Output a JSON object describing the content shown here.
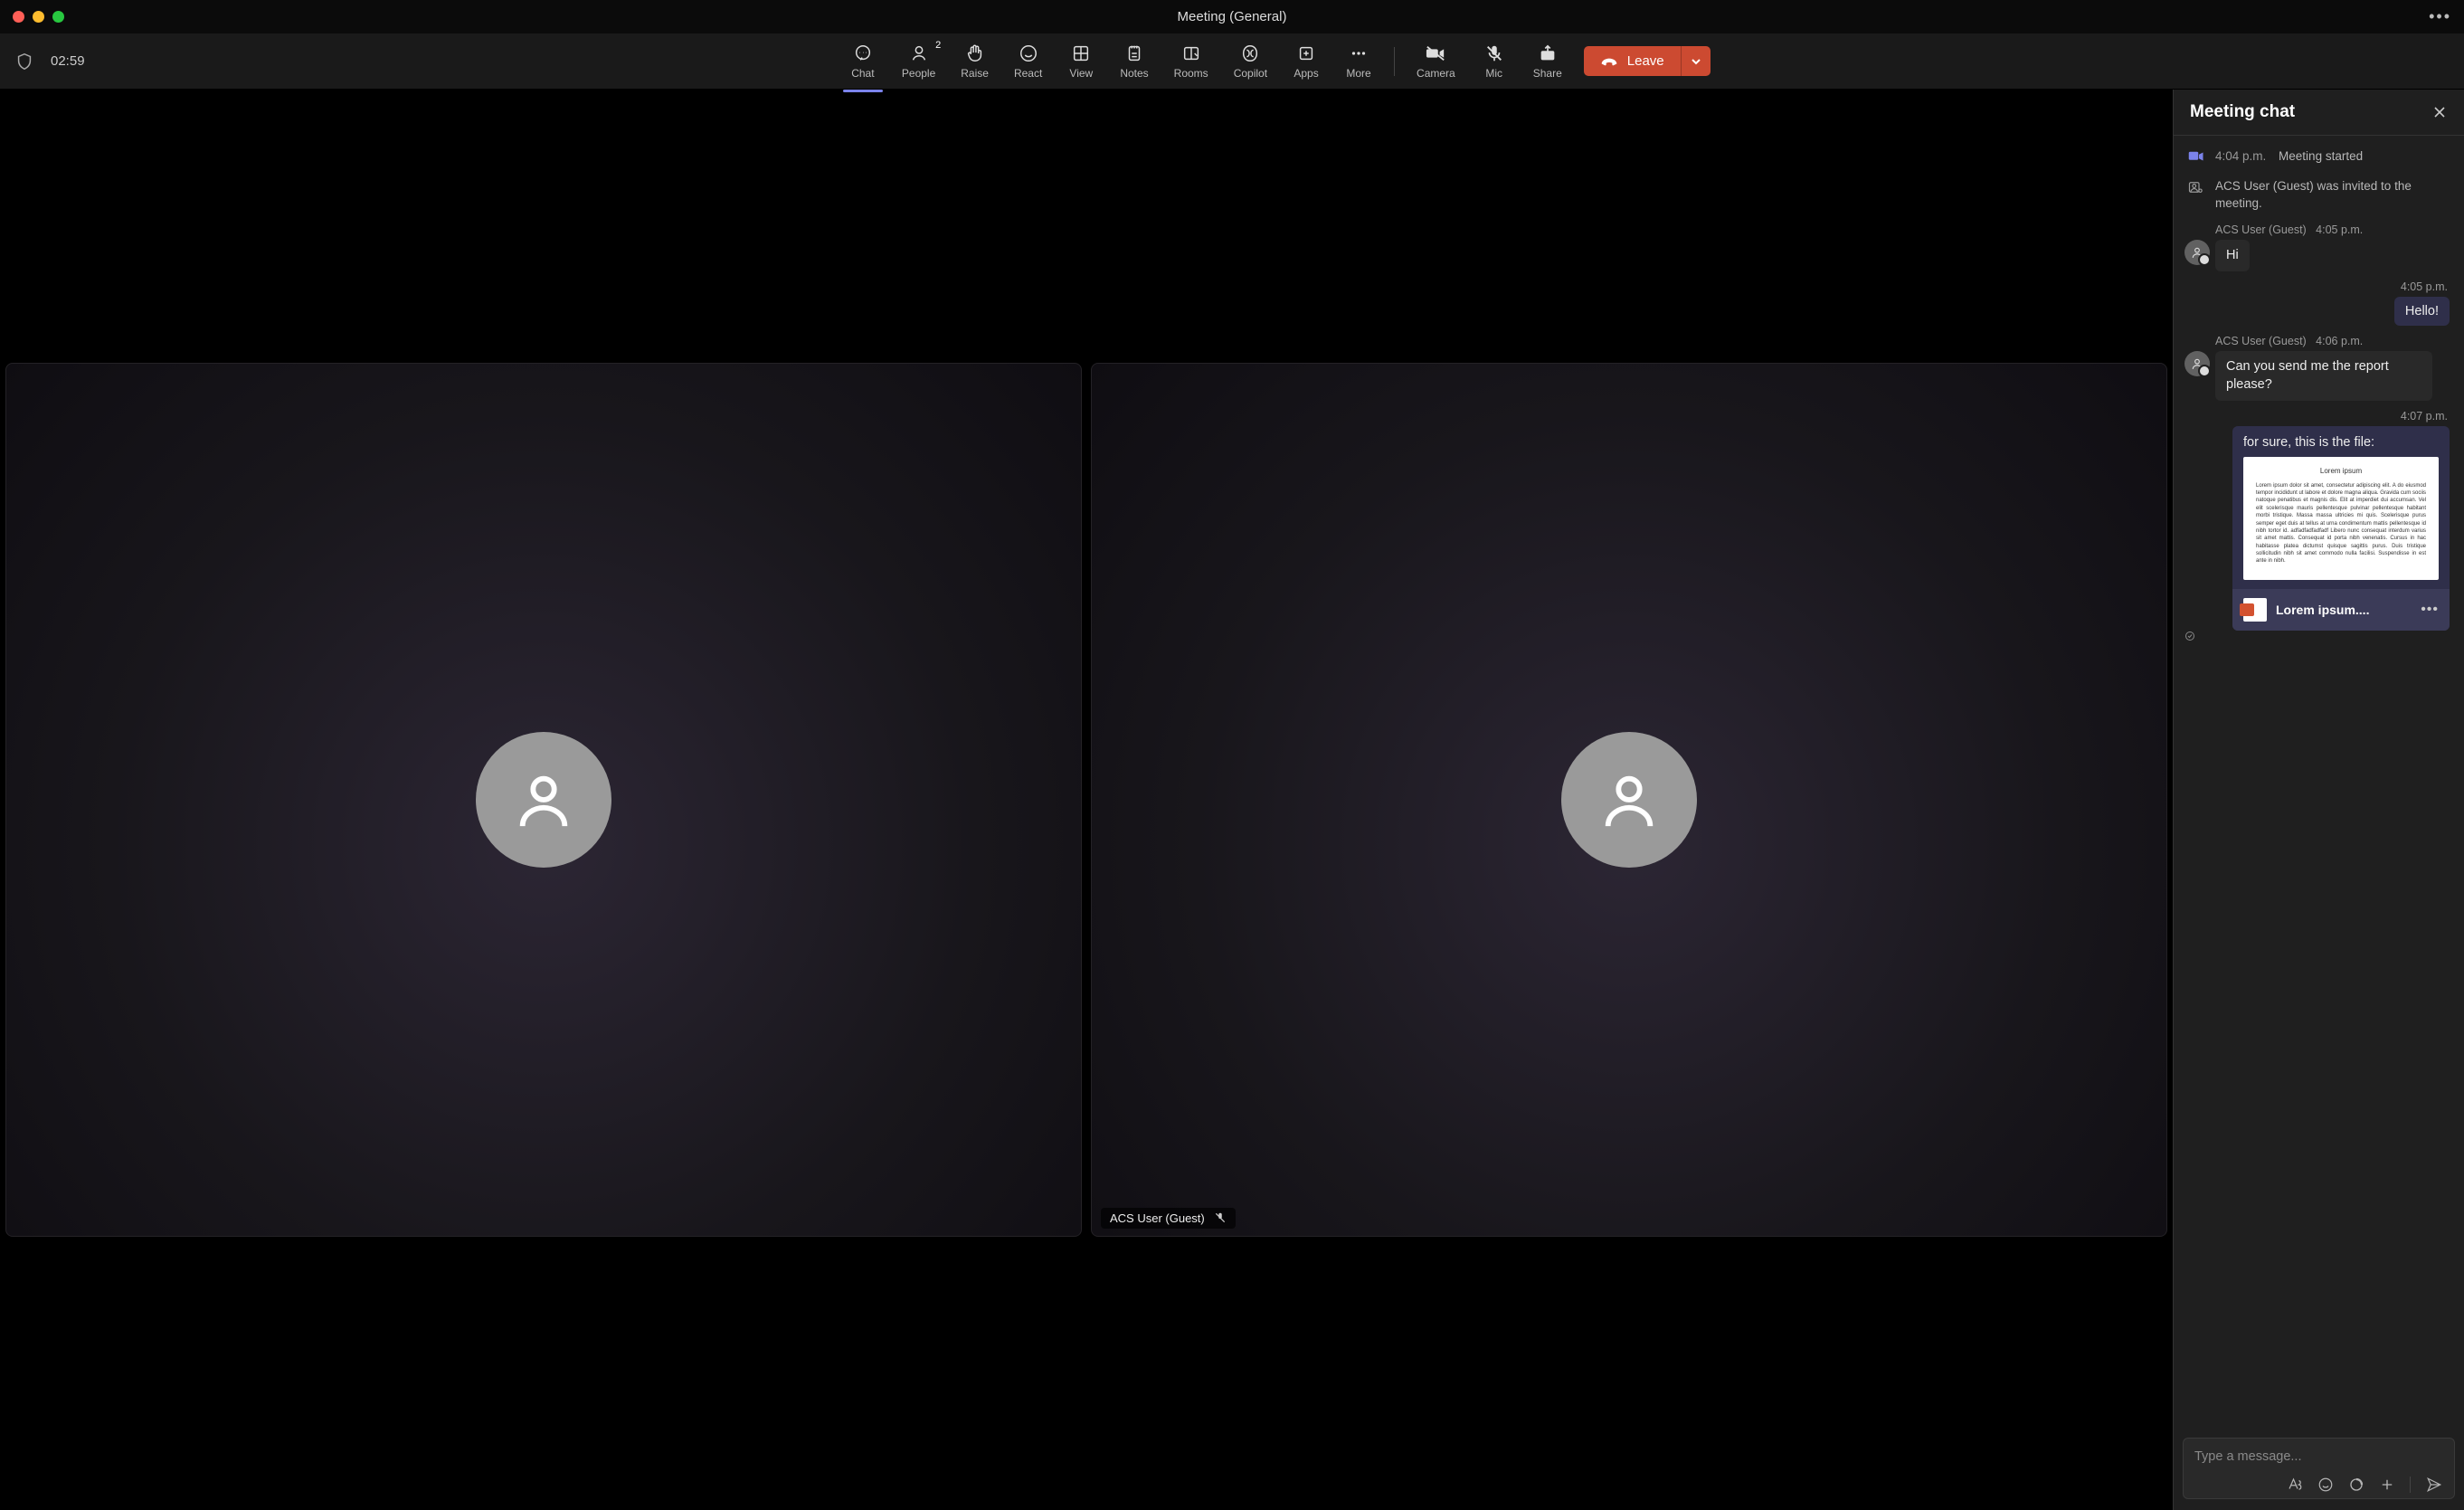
{
  "window": {
    "title": "Meeting (General)"
  },
  "toolbar": {
    "timer": "02:59",
    "buttons": {
      "chat": "Chat",
      "people": "People",
      "people_count": "2",
      "raise": "Raise",
      "react": "React",
      "view": "View",
      "notes": "Notes",
      "rooms": "Rooms",
      "copilot": "Copilot",
      "apps": "Apps",
      "more": "More",
      "camera": "Camera",
      "mic": "Mic",
      "share": "Share",
      "leave": "Leave"
    }
  },
  "stage": {
    "tile2_name": "ACS User (Guest)"
  },
  "panel": {
    "title": "Meeting chat",
    "sys1_time": "4:04 p.m.",
    "sys1_text": "Meeting started",
    "sys2_text": "ACS User (Guest) was invited to the meeting.",
    "msg1_author": "ACS User (Guest)",
    "msg1_time": "4:05 p.m.",
    "msg1_text": "Hi",
    "msg2_time": "4:05 p.m.",
    "msg2_text": "Hello!",
    "msg3_author": "ACS User (Guest)",
    "msg3_time": "4:06 p.m.",
    "msg3_text": "Can you send me the report please?",
    "msg4_time": "4:07 p.m.",
    "msg4_caption": "for sure, this is the file:",
    "msg4_doc_title": "Lorem ipsum",
    "msg4_doc_body": "Lorem ipsum dolor sit amet, consectetur adipiscing elit. A do eiusmod tempor incididunt ut labore et dolore magna aliqua. Gravida cum sociis natoque penatibus et magnis dis. Elit at imperdiet dui accumsan. Vel elit scelerisque mauris pellentesque pulvinar pellentesque habitant morbi tristique. Massa massa ultricies mi quis. Scelerisque purus semper eget duis at tellus at urna condimentum mattis pellentesque id nibh tortor id. adfadfadfadfadf Libero nunc consequat interdum varius sit amet mattis. Consequat id porta nibh venenatis. Cursus in hac habitasse platea dictumst quisque sagittis purus. Duis tristique sollicitudin nibh sit amet commodo nulla facilisi. Suspendisse in est ante in nibh.",
    "msg4_filename": "Lorem ipsum....",
    "compose_placeholder": "Type a message..."
  }
}
